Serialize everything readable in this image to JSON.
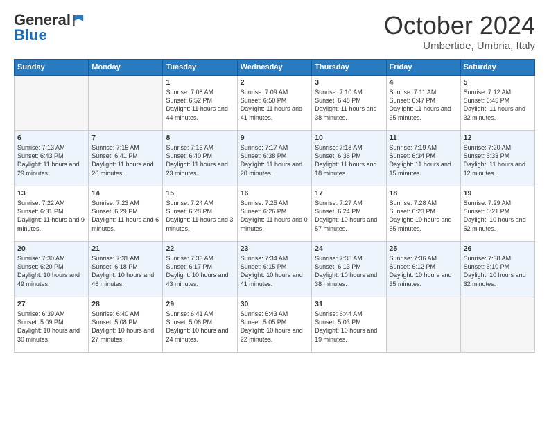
{
  "logo": {
    "general": "General",
    "blue": "Blue"
  },
  "header": {
    "month": "October 2024",
    "location": "Umbertide, Umbria, Italy"
  },
  "days": [
    "Sunday",
    "Monday",
    "Tuesday",
    "Wednesday",
    "Thursday",
    "Friday",
    "Saturday"
  ],
  "weeks": [
    [
      {
        "date": "",
        "sunrise": "",
        "sunset": "",
        "daylight": ""
      },
      {
        "date": "",
        "sunrise": "",
        "sunset": "",
        "daylight": ""
      },
      {
        "date": "1",
        "sunrise": "Sunrise: 7:08 AM",
        "sunset": "Sunset: 6:52 PM",
        "daylight": "Daylight: 11 hours and 44 minutes."
      },
      {
        "date": "2",
        "sunrise": "Sunrise: 7:09 AM",
        "sunset": "Sunset: 6:50 PM",
        "daylight": "Daylight: 11 hours and 41 minutes."
      },
      {
        "date": "3",
        "sunrise": "Sunrise: 7:10 AM",
        "sunset": "Sunset: 6:48 PM",
        "daylight": "Daylight: 11 hours and 38 minutes."
      },
      {
        "date": "4",
        "sunrise": "Sunrise: 7:11 AM",
        "sunset": "Sunset: 6:47 PM",
        "daylight": "Daylight: 11 hours and 35 minutes."
      },
      {
        "date": "5",
        "sunrise": "Sunrise: 7:12 AM",
        "sunset": "Sunset: 6:45 PM",
        "daylight": "Daylight: 11 hours and 32 minutes."
      }
    ],
    [
      {
        "date": "6",
        "sunrise": "Sunrise: 7:13 AM",
        "sunset": "Sunset: 6:43 PM",
        "daylight": "Daylight: 11 hours and 29 minutes."
      },
      {
        "date": "7",
        "sunrise": "Sunrise: 7:15 AM",
        "sunset": "Sunset: 6:41 PM",
        "daylight": "Daylight: 11 hours and 26 minutes."
      },
      {
        "date": "8",
        "sunrise": "Sunrise: 7:16 AM",
        "sunset": "Sunset: 6:40 PM",
        "daylight": "Daylight: 11 hours and 23 minutes."
      },
      {
        "date": "9",
        "sunrise": "Sunrise: 7:17 AM",
        "sunset": "Sunset: 6:38 PM",
        "daylight": "Daylight: 11 hours and 20 minutes."
      },
      {
        "date": "10",
        "sunrise": "Sunrise: 7:18 AM",
        "sunset": "Sunset: 6:36 PM",
        "daylight": "Daylight: 11 hours and 18 minutes."
      },
      {
        "date": "11",
        "sunrise": "Sunrise: 7:19 AM",
        "sunset": "Sunset: 6:34 PM",
        "daylight": "Daylight: 11 hours and 15 minutes."
      },
      {
        "date": "12",
        "sunrise": "Sunrise: 7:20 AM",
        "sunset": "Sunset: 6:33 PM",
        "daylight": "Daylight: 11 hours and 12 minutes."
      }
    ],
    [
      {
        "date": "13",
        "sunrise": "Sunrise: 7:22 AM",
        "sunset": "Sunset: 6:31 PM",
        "daylight": "Daylight: 11 hours and 9 minutes."
      },
      {
        "date": "14",
        "sunrise": "Sunrise: 7:23 AM",
        "sunset": "Sunset: 6:29 PM",
        "daylight": "Daylight: 11 hours and 6 minutes."
      },
      {
        "date": "15",
        "sunrise": "Sunrise: 7:24 AM",
        "sunset": "Sunset: 6:28 PM",
        "daylight": "Daylight: 11 hours and 3 minutes."
      },
      {
        "date": "16",
        "sunrise": "Sunrise: 7:25 AM",
        "sunset": "Sunset: 6:26 PM",
        "daylight": "Daylight: 11 hours and 0 minutes."
      },
      {
        "date": "17",
        "sunrise": "Sunrise: 7:27 AM",
        "sunset": "Sunset: 6:24 PM",
        "daylight": "Daylight: 10 hours and 57 minutes."
      },
      {
        "date": "18",
        "sunrise": "Sunrise: 7:28 AM",
        "sunset": "Sunset: 6:23 PM",
        "daylight": "Daylight: 10 hours and 55 minutes."
      },
      {
        "date": "19",
        "sunrise": "Sunrise: 7:29 AM",
        "sunset": "Sunset: 6:21 PM",
        "daylight": "Daylight: 10 hours and 52 minutes."
      }
    ],
    [
      {
        "date": "20",
        "sunrise": "Sunrise: 7:30 AM",
        "sunset": "Sunset: 6:20 PM",
        "daylight": "Daylight: 10 hours and 49 minutes."
      },
      {
        "date": "21",
        "sunrise": "Sunrise: 7:31 AM",
        "sunset": "Sunset: 6:18 PM",
        "daylight": "Daylight: 10 hours and 46 minutes."
      },
      {
        "date": "22",
        "sunrise": "Sunrise: 7:33 AM",
        "sunset": "Sunset: 6:17 PM",
        "daylight": "Daylight: 10 hours and 43 minutes."
      },
      {
        "date": "23",
        "sunrise": "Sunrise: 7:34 AM",
        "sunset": "Sunset: 6:15 PM",
        "daylight": "Daylight: 10 hours and 41 minutes."
      },
      {
        "date": "24",
        "sunrise": "Sunrise: 7:35 AM",
        "sunset": "Sunset: 6:13 PM",
        "daylight": "Daylight: 10 hours and 38 minutes."
      },
      {
        "date": "25",
        "sunrise": "Sunrise: 7:36 AM",
        "sunset": "Sunset: 6:12 PM",
        "daylight": "Daylight: 10 hours and 35 minutes."
      },
      {
        "date": "26",
        "sunrise": "Sunrise: 7:38 AM",
        "sunset": "Sunset: 6:10 PM",
        "daylight": "Daylight: 10 hours and 32 minutes."
      }
    ],
    [
      {
        "date": "27",
        "sunrise": "Sunrise: 6:39 AM",
        "sunset": "Sunset: 5:09 PM",
        "daylight": "Daylight: 10 hours and 30 minutes."
      },
      {
        "date": "28",
        "sunrise": "Sunrise: 6:40 AM",
        "sunset": "Sunset: 5:08 PM",
        "daylight": "Daylight: 10 hours and 27 minutes."
      },
      {
        "date": "29",
        "sunrise": "Sunrise: 6:41 AM",
        "sunset": "Sunset: 5:06 PM",
        "daylight": "Daylight: 10 hours and 24 minutes."
      },
      {
        "date": "30",
        "sunrise": "Sunrise: 6:43 AM",
        "sunset": "Sunset: 5:05 PM",
        "daylight": "Daylight: 10 hours and 22 minutes."
      },
      {
        "date": "31",
        "sunrise": "Sunrise: 6:44 AM",
        "sunset": "Sunset: 5:03 PM",
        "daylight": "Daylight: 10 hours and 19 minutes."
      },
      {
        "date": "",
        "sunrise": "",
        "sunset": "",
        "daylight": ""
      },
      {
        "date": "",
        "sunrise": "",
        "sunset": "",
        "daylight": ""
      }
    ]
  ]
}
